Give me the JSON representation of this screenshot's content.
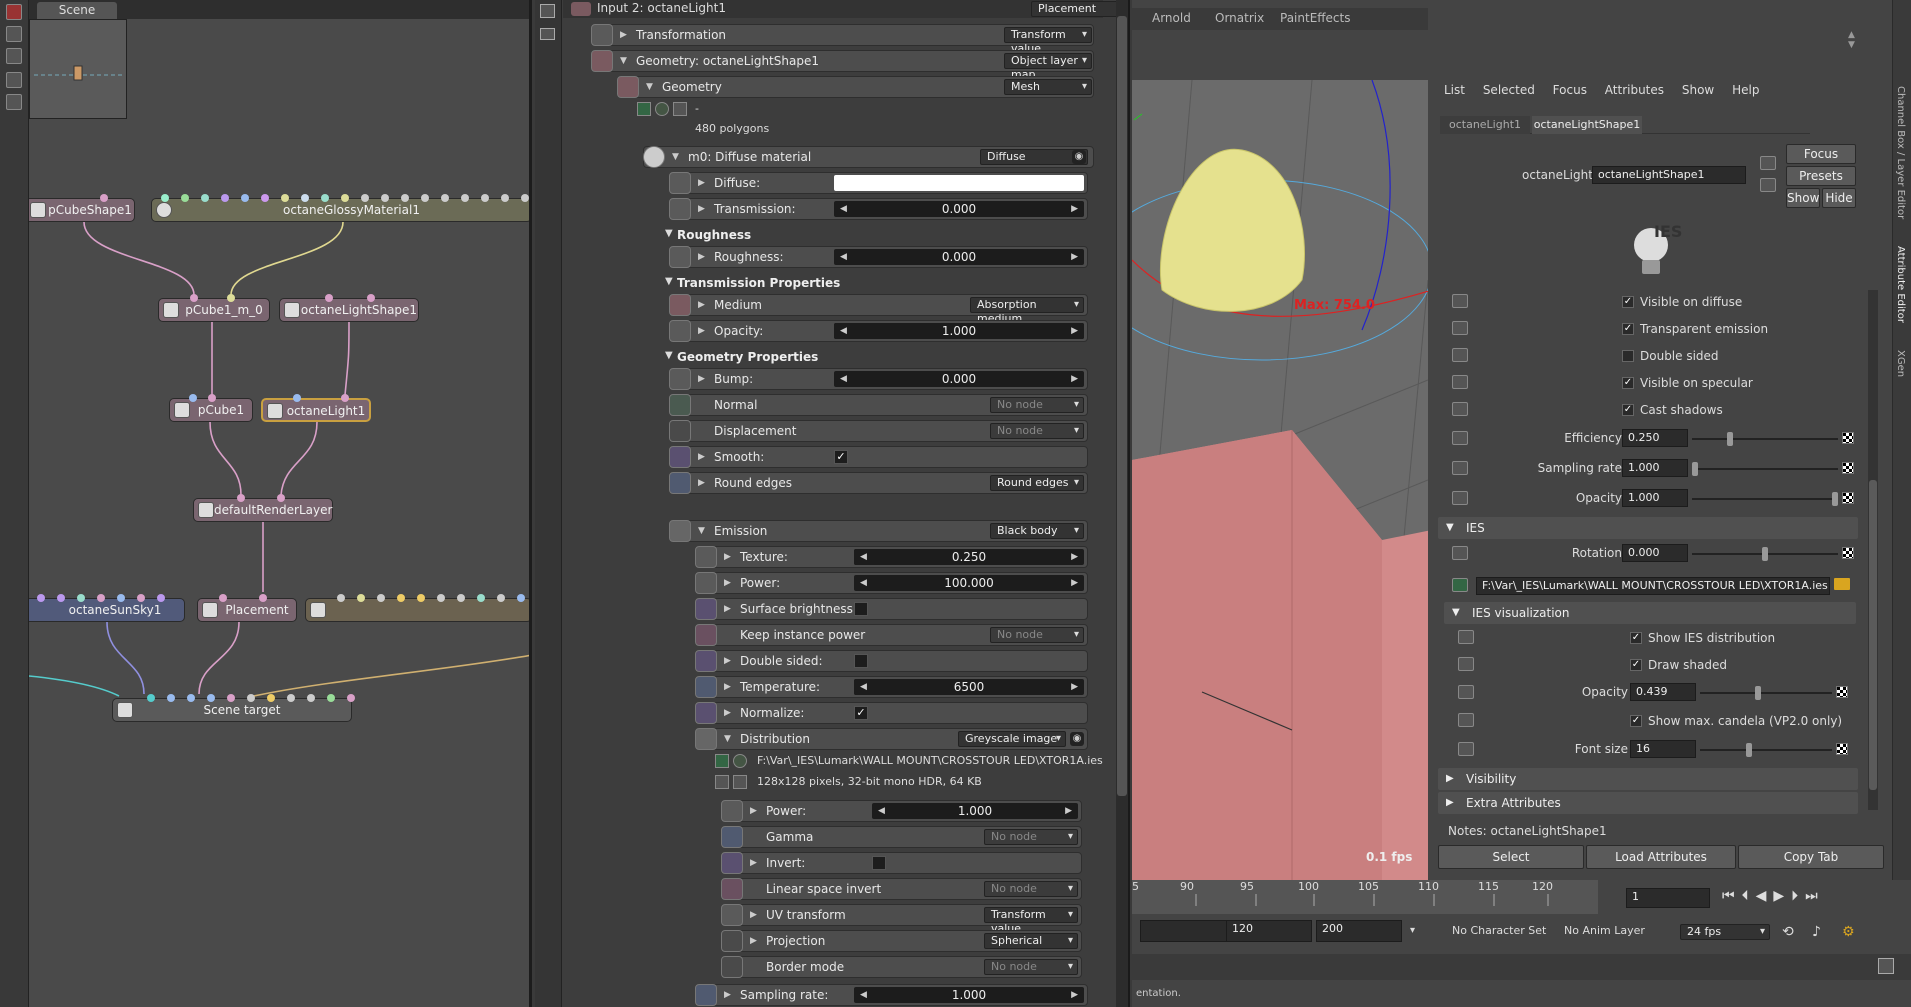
{
  "graph": {
    "tab": "Scene",
    "nodes": {
      "pcubeshape": "pCubeShape1",
      "glossy": "octaneGlossyMaterial1",
      "pcube_m0": "pCube1_m_0",
      "lightshape": "octaneLightShape1",
      "pcube1": "pCube1",
      "light1": "octaneLight1",
      "renderlayer": "defaultRenderLayer",
      "sunsky": "octaneSunSky1",
      "placement": "Placement",
      "scene_target": "Scene target"
    }
  },
  "attr": {
    "header": "Input 2: octaneLight1",
    "header_dd": "Placement",
    "transformation": "Transformation",
    "transformation_dd": "Transform value",
    "geometry_node": "Geometry: octaneLightShape1",
    "geometry_node_dd": "Object layer map",
    "geometry": "Geometry",
    "geometry_dd": "Mesh",
    "geometry_info1": "-",
    "geometry_info2": "480 polygons",
    "material": "m0: Diffuse material",
    "material_dd": "Diffuse",
    "diffuse": "Diffuse:",
    "transmission": "Transmission:",
    "transmission_val": "0.000",
    "roughness_sect": "Roughness",
    "roughness": "Roughness:",
    "roughness_val": "0.000",
    "trans_props": "Transmission Properties",
    "medium": "Medium",
    "medium_dd": "Absorption medium",
    "opacity": "Opacity:",
    "opacity_val": "1.000",
    "geo_props": "Geometry Properties",
    "bump": "Bump:",
    "bump_val": "0.000",
    "normal": "Normal",
    "no_node": "No node",
    "displacement": "Displacement",
    "smooth": "Smooth:",
    "check": "✓",
    "round_edges": "Round edges",
    "round_edges_dd": "Round edges",
    "emission": "Emission",
    "emission_dd": "Black body",
    "texture": "Texture:",
    "texture_val": "0.250",
    "power": "Power:",
    "power_val": "100.000",
    "surface_brightness": "Surface brightness:",
    "keep_instance_power": "Keep instance power",
    "double_sided": "Double sided:",
    "temperature": "Temperature:",
    "temperature_val": "6500",
    "normalize": "Normalize:",
    "distribution": "Distribution",
    "distribution_dd": "Greyscale image",
    "dist_path": "F:\\Var\\_IES\\Lumark\\WALL MOUNT\\CROSSTOUR LED\\XTOR1A.ies",
    "dist_info": "128x128 pixels, 32-bit mono HDR, 64 KB",
    "d_power": "Power:",
    "d_power_val": "1.000",
    "gamma": "Gamma",
    "invert": "Invert:",
    "linear_space_invert": "Linear space invert",
    "uv_transform": "UV transform",
    "uv_transform_dd": "Transform value",
    "projection": "Projection",
    "projection_dd": "Spherical",
    "border_mode": "Border mode",
    "sampling_rate": "Sampling rate:",
    "sampling_rate_val": "1.000"
  },
  "viewport": {
    "tabs": [
      "Arnold",
      "Ornatrix",
      "PaintEffects"
    ],
    "max_label": "Max: 754.0",
    "fps": "0.1 fps"
  },
  "channel_box": {
    "menu": [
      "List",
      "Selected",
      "Focus",
      "Attributes",
      "Show",
      "Help"
    ],
    "tabs": [
      "octaneLight1",
      "octaneLightShape1"
    ],
    "name_label": "octaneLight:",
    "name_value": "octaneLightShape1",
    "focus_btn": "Focus",
    "presets_btn": "Presets",
    "show_btn": "Show",
    "hide_btn": "Hide",
    "ies_logo": "IES",
    "visible_on_diffuse": "Visible on diffuse",
    "transparent_emission": "Transparent emission",
    "double_sided": "Double sided",
    "visible_on_specular": "Visible on specular",
    "cast_shadows": "Cast shadows",
    "efficiency": "Efficiency",
    "efficiency_val": "0.250",
    "efficiency_frac": 0.25,
    "sampling_rate": "Sampling rate",
    "sampling_rate_val": "1.000",
    "sampling_rate_frac": 0.0,
    "opacity": "Opacity",
    "opacity_val": "1.000",
    "opacity_frac": 1.0,
    "ies_section": "IES",
    "rotation": "Rotation",
    "rotation_val": "0.000",
    "ies_path": "F:\\Var\\_IES\\Lumark\\WALL MOUNT\\CROSSTOUR LED\\XTOR1A.ies",
    "ies_vis_section": "IES visualization",
    "show_ies_distribution": "Show IES distribution",
    "draw_shaded": "Draw shaded",
    "vis_opacity": "Opacity",
    "vis_opacity_val": "0.439",
    "vis_opacity_frac": 0.439,
    "show_max_candela": "Show max. candela (VP2.0 only)",
    "font_size": "Font size",
    "font_size_val": "16",
    "visibility_section": "Visibility",
    "extra_section": "Extra Attributes",
    "notes": "Notes:  octaneLightShape1",
    "select_btn": "Select",
    "load_btn": "Load Attributes",
    "copy_btn": "Copy Tab",
    "side_tabs": [
      "Channel Box / Layer Editor",
      "Attribute Editor",
      "XGen"
    ]
  },
  "timeline": {
    "ticks": [
      "5",
      "90",
      "95",
      "100",
      "105",
      "110",
      "115",
      "120"
    ],
    "current_frame": "1",
    "range_start": "120",
    "range_end": "200",
    "char_set": "No Character Set",
    "anim_layer": "No Anim Layer",
    "fps": "24 fps",
    "help_line": "entation."
  }
}
